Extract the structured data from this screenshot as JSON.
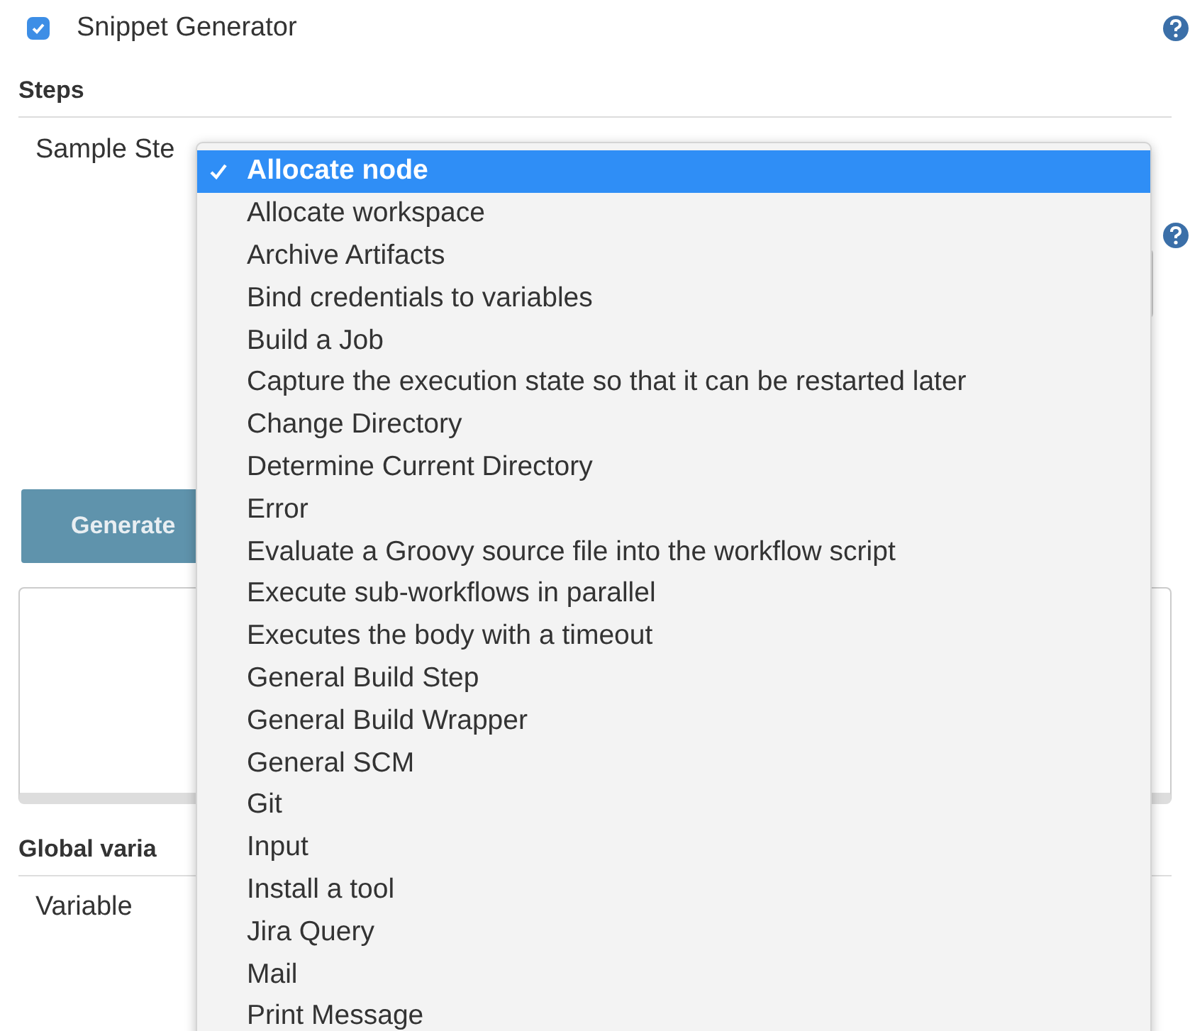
{
  "snippet_generator": {
    "label": "Snippet Generator",
    "checked": true
  },
  "steps": {
    "heading": "Steps",
    "sample_step_label": "Sample Ste"
  },
  "generate_button": "Generate",
  "global_variables": {
    "heading": "Global varia",
    "variable_label": "Variable"
  },
  "dropdown": {
    "items": [
      {
        "label": "Allocate node",
        "selected": true
      },
      {
        "label": "Allocate workspace",
        "selected": false
      },
      {
        "label": "Archive Artifacts",
        "selected": false
      },
      {
        "label": "Bind credentials to variables",
        "selected": false
      },
      {
        "label": "Build a Job",
        "selected": false
      },
      {
        "label": "Capture the execution state so that it can be restarted later",
        "selected": false
      },
      {
        "label": "Change Directory",
        "selected": false
      },
      {
        "label": "Determine Current Directory",
        "selected": false
      },
      {
        "label": "Error",
        "selected": false
      },
      {
        "label": "Evaluate a Groovy source file into the workflow script",
        "selected": false
      },
      {
        "label": "Execute sub-workflows in parallel",
        "selected": false
      },
      {
        "label": "Executes the body with a timeout",
        "selected": false
      },
      {
        "label": "General Build Step",
        "selected": false
      },
      {
        "label": "General Build Wrapper",
        "selected": false
      },
      {
        "label": "General SCM",
        "selected": false
      },
      {
        "label": "Git",
        "selected": false
      },
      {
        "label": "Input",
        "selected": false
      },
      {
        "label": "Install a tool",
        "selected": false
      },
      {
        "label": "Jira Query",
        "selected": false
      },
      {
        "label": "Mail",
        "selected": false
      },
      {
        "label": "Print Message",
        "selected": false
      }
    ]
  }
}
